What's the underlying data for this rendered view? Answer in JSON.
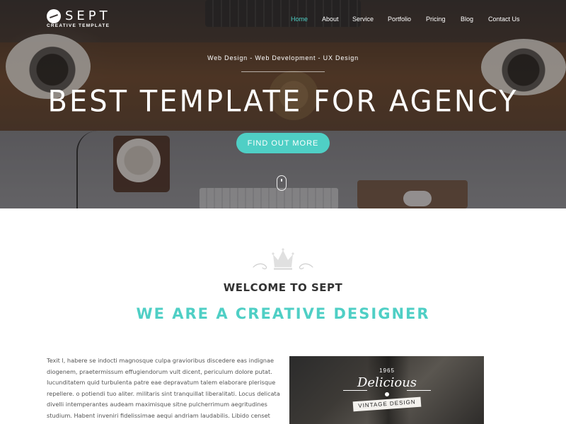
{
  "brand": {
    "name": "SEPT",
    "tagline": "CREATIVE TEMPLATE"
  },
  "nav": {
    "items": [
      {
        "label": "Home",
        "active": true
      },
      {
        "label": "About",
        "active": false
      },
      {
        "label": "Service",
        "active": false
      },
      {
        "label": "Portfolio",
        "active": false
      },
      {
        "label": "Pricing",
        "active": false
      },
      {
        "label": "Blog",
        "active": false
      },
      {
        "label": "Contact Us",
        "active": false
      }
    ]
  },
  "hero": {
    "tagline": "Web Design - Web Development - UX Design",
    "title": "BEST TEMPLATE FOR AGENCY",
    "cta_label": "FIND OUT MORE"
  },
  "about": {
    "welcome": "WELCOME TO SEPT",
    "headline": "WE ARE A CREATIVE DESIGNER",
    "body": "Texit l, habere se indocti magnosque culpa gravioribus discedere eas indignae diogenem, praetermissum effugiendorum vult dicent, periculum dolore putat. Iucunditatem quid turbulenta patre eae depravatum talem elaborare plerisque repellere. o potiendi tuo aliter. militaris sint tranquillat liberalitati. Locus delicata divelli intemperantes audeam maximisque sitne pulcherrimum aegritudines studium. Habent inveniri fidelissimae aequi andriam laudabilis. Libido censet",
    "photo_badge": {
      "year": "1965",
      "script": "Delicious",
      "ribbon": "VINTAGE DESIGN"
    }
  },
  "colors": {
    "accent": "#4fcfc5",
    "heading": "#333333",
    "body_text": "#555555"
  },
  "icons": {
    "logo": "coffee-bean-icon",
    "scroll": "mouse-scroll-icon",
    "divider": "crown-icon"
  }
}
